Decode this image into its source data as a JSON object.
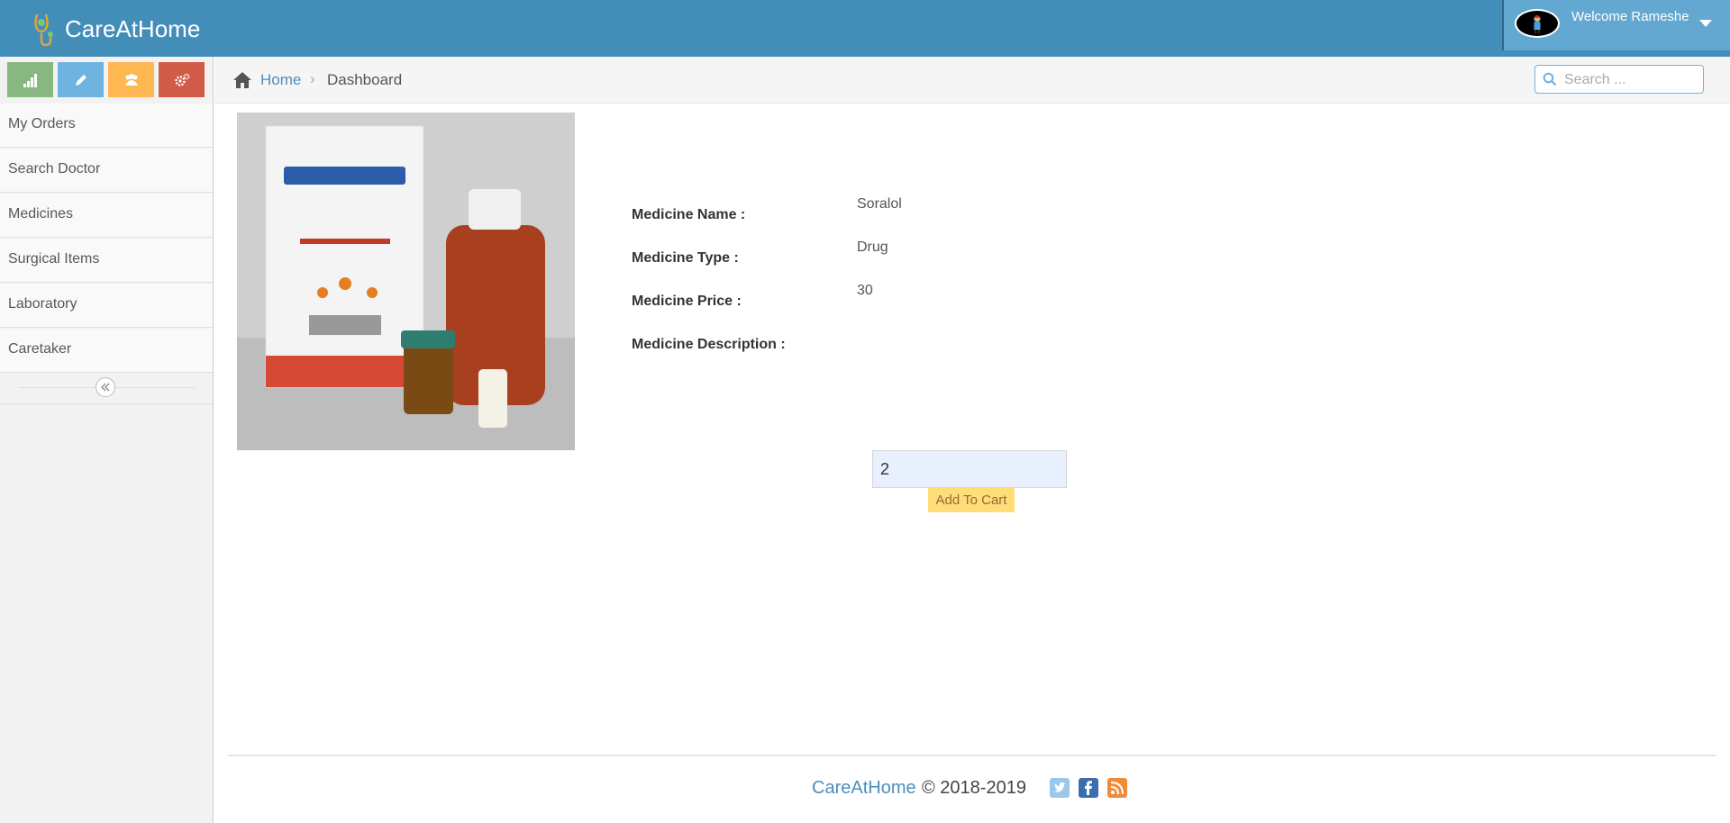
{
  "header": {
    "brand": "CareAtHome",
    "welcome": "Welcome Rameshe"
  },
  "shortcuts": [
    {
      "icon": "signal-icon",
      "color": "#87b87f"
    },
    {
      "icon": "pencil-icon",
      "color": "#6fb3e0"
    },
    {
      "icon": "users-icon",
      "color": "#ffb752"
    },
    {
      "icon": "cogs-icon",
      "color": "#d15b47"
    }
  ],
  "sidebar": {
    "items": [
      {
        "label": "My Orders"
      },
      {
        "label": "Search Doctor"
      },
      {
        "label": "Medicines"
      },
      {
        "label": "Surgical Items"
      },
      {
        "label": "Laboratory"
      },
      {
        "label": "Caretaker"
      }
    ]
  },
  "breadcrumb": {
    "home": "Home",
    "current": "Dashboard"
  },
  "search": {
    "placeholder": "Search ..."
  },
  "product": {
    "image_label": "ClearChoice SUB Solution kit",
    "name_label": "Medicine Name :",
    "name_value": "Soralol",
    "type_label": "Medicine Type :",
    "type_value": "Drug",
    "price_label": "Medicine Price :",
    "price_value": "30",
    "description_label": "Medicine Description :",
    "description_value": "",
    "quantity": "2",
    "add_to_cart": "Add To Cart"
  },
  "footer": {
    "brand": "CareAtHome",
    "copyright": "© 2018-2019"
  },
  "colors": {
    "header": "#438eb9",
    "link": "#4c8fbd",
    "cart_button": "#ffde7a"
  }
}
